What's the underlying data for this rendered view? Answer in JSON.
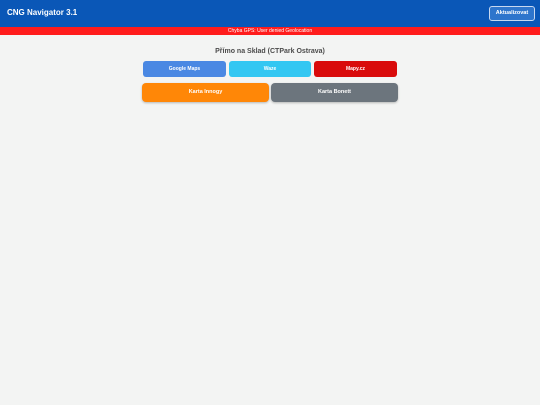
{
  "header": {
    "title": "CNG Navigator 3.1",
    "refresh_label": "Aktualizovat"
  },
  "error": {
    "message": "Chyba GPS: User denied Geolocation"
  },
  "route": {
    "title": "Přímo na Sklad (CTPark Ostrava)"
  },
  "navigation_buttons": [
    {
      "label": "Google Maps",
      "color": "#4a88e3"
    },
    {
      "label": "Waze",
      "color": "#33c7f2"
    },
    {
      "label": "Mapy.cz",
      "color": "#d90b0b"
    }
  ],
  "card_buttons": [
    {
      "label": "Karta Innogy",
      "color": "#ff8707"
    },
    {
      "label": "Karta Bonett",
      "color": "#6c757d"
    }
  ],
  "colors": {
    "header_bg": "#0a57b7",
    "error_bg": "#ff1c1c",
    "page_bg": "#f3f4f3"
  }
}
